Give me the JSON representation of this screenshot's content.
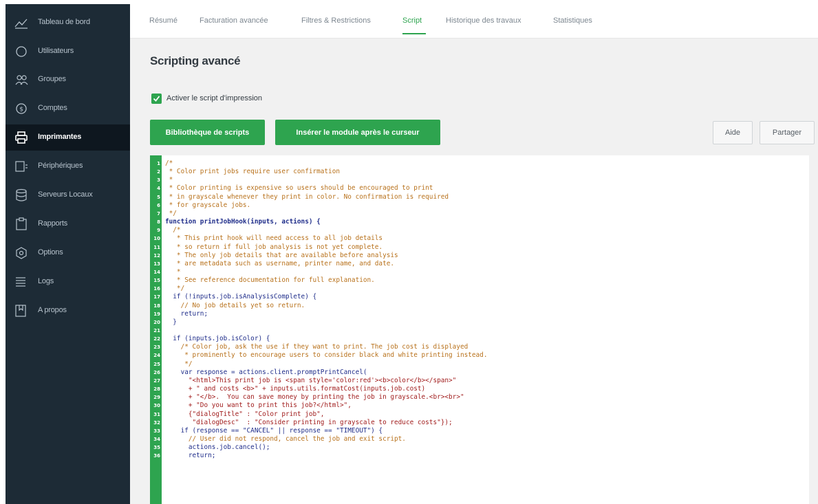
{
  "sidebar": {
    "items": [
      {
        "label": "Tableau de bord",
        "icon": "chart-line-icon"
      },
      {
        "label": "Utilisateurs",
        "icon": "user-circle-icon"
      },
      {
        "label": "Groupes",
        "icon": "users-group-icon"
      },
      {
        "label": "Comptes",
        "icon": "dollar-circle-icon"
      },
      {
        "label": "Imprimantes",
        "icon": "printer-icon"
      },
      {
        "label": "Périphériques",
        "icon": "device-icon"
      },
      {
        "label": "Serveurs Locaux",
        "icon": "database-icon"
      },
      {
        "label": "Rapports",
        "icon": "clipboard-icon"
      },
      {
        "label": "Options",
        "icon": "settings-hex-icon"
      },
      {
        "label": "Logs",
        "icon": "list-icon"
      },
      {
        "label": "A propos",
        "icon": "book-icon"
      }
    ],
    "active": "Imprimantes"
  },
  "tabs": [
    "Résumé",
    "Facturation avancée",
    "Filtres & Restrictions",
    "Script",
    "Historique des travaux",
    "Statistiques"
  ],
  "active_tab": "Script",
  "page_title": "Scripting avancé",
  "checkbox_label": "Activer le script d'impression",
  "buttons": {
    "library": "Bibliothèque de scripts",
    "insert": "Insérer le module après le curseur",
    "help": "Aide",
    "share": "Partager"
  },
  "colors": {
    "accent": "#2ea44f",
    "sidebar": "#1d2b36"
  },
  "code_lines": [
    {
      "n": "1",
      "t": "/*",
      "k": "c"
    },
    {
      "n": "2",
      "t": " * Color print jobs require user confirmation",
      "k": "c"
    },
    {
      "n": "3",
      "t": " *",
      "k": "c"
    },
    {
      "n": "4",
      "t": " * Color printing is expensive so users should be encouraged to print",
      "k": "c"
    },
    {
      "n": "5",
      "t": " * in grayscale whenever they print in color. No confirmation is required",
      "k": "c"
    },
    {
      "n": "6",
      "t": " * for grayscale jobs.",
      "k": "c"
    },
    {
      "n": "7",
      "t": " */",
      "k": "c"
    },
    {
      "n": "8",
      "t": "function printJobHook(inputs, actions) {",
      "k": "k"
    },
    {
      "n": "9",
      "t": "  /*",
      "k": "c"
    },
    {
      "n": "10",
      "t": "   * This print hook will need access to all job details",
      "k": "c"
    },
    {
      "n": "11",
      "t": "   * so return if full job analysis is not yet complete.",
      "k": "c"
    },
    {
      "n": "12",
      "t": "   * The only job details that are available before analysis",
      "k": "c"
    },
    {
      "n": "13",
      "t": "   * are metadata such as username, printer name, and date.",
      "k": "c"
    },
    {
      "n": "14",
      "t": "   *",
      "k": "c"
    },
    {
      "n": "15",
      "t": "   * See reference documentation for full explanation.",
      "k": "c"
    },
    {
      "n": "16",
      "t": "   */",
      "k": "c"
    },
    {
      "n": "17",
      "t": "  if (!inputs.job.isAnalysisComplete) {",
      "k": "p"
    },
    {
      "n": "18",
      "t": "    // No job details yet so return.",
      "k": "c"
    },
    {
      "n": "19",
      "t": "    return;",
      "k": "p"
    },
    {
      "n": "20",
      "t": "  }",
      "k": "p"
    },
    {
      "n": "21",
      "t": "",
      "k": "p"
    },
    {
      "n": "22",
      "t": "  if (inputs.job.isColor) {",
      "k": "p"
    },
    {
      "n": "23",
      "t": "    /* Color job, ask the use if they want to print. The job cost is displayed",
      "k": "c"
    },
    {
      "n": "24",
      "t": "     * prominently to encourage users to consider black and white printing instead.",
      "k": "c"
    },
    {
      "n": "25",
      "t": "     */",
      "k": "c"
    },
    {
      "n": "26",
      "t": "    var response = actions.client.promptPrintCancel(",
      "k": "p"
    },
    {
      "n": "27",
      "t": "      \"<html>This print job is <span style='color:red'><b>color</b></span>\"",
      "k": "s"
    },
    {
      "n": "28",
      "t": "      + \" and costs <b>\" + inputs.utils.formatCost(inputs.job.cost)",
      "k": "s"
    },
    {
      "n": "29",
      "t": "      + \"</b>.  You can save money by printing the job in grayscale.<br><br>\"",
      "k": "s"
    },
    {
      "n": "30",
      "t": "      + \"Do you want to print this job?</html>\",",
      "k": "s"
    },
    {
      "n": "31",
      "t": "      {\"dialogTitle\" : \"Color print job\",",
      "k": "s"
    },
    {
      "n": "32",
      "t": "       \"dialogDesc\"  : \"Consider printing in grayscale to reduce costs\"});",
      "k": "s"
    },
    {
      "n": "33",
      "t": "    if (response == \"CANCEL\" || response == \"TIMEOUT\") {",
      "k": "p"
    },
    {
      "n": "34",
      "t": "      // User did not respond, cancel the job and exit script.",
      "k": "c"
    },
    {
      "n": "35",
      "t": "      actions.job.cancel();",
      "k": "p"
    },
    {
      "n": "36",
      "t": "      return;",
      "k": "p"
    }
  ]
}
